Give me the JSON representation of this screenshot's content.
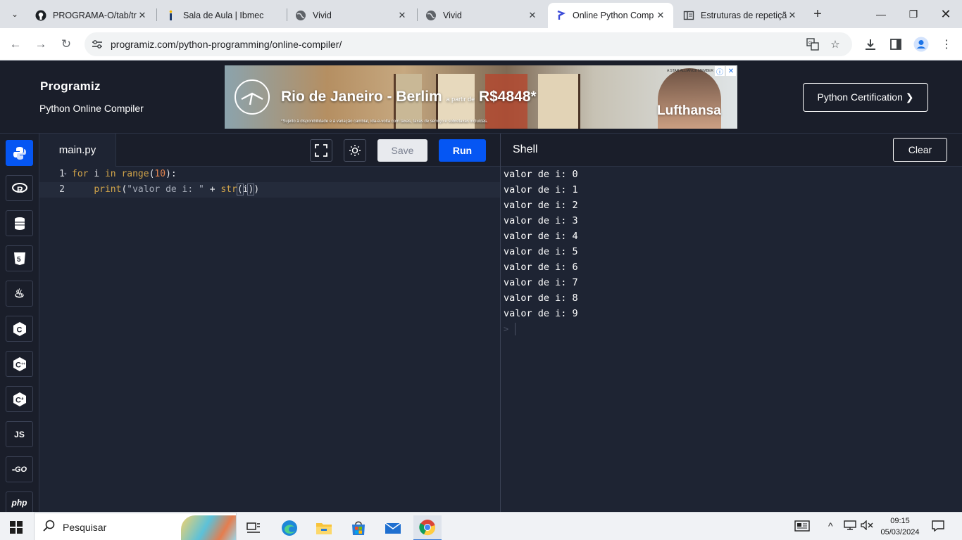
{
  "browser": {
    "tabs": [
      {
        "title": "PROGRAMA-O/tab/tr",
        "icon": "github-icon",
        "active": false
      },
      {
        "title": "Sala de Aula | Ibmec",
        "icon": "ibmec-icon",
        "active": false
      },
      {
        "title": "Vivid",
        "icon": "globe-icon",
        "active": false
      },
      {
        "title": "Vivid",
        "icon": "globe-icon",
        "active": false
      },
      {
        "title": "Online Python Comp",
        "icon": "programiz-icon",
        "active": true
      },
      {
        "title": "Estruturas de repetiçã",
        "icon": "book-icon",
        "active": false
      }
    ],
    "url": "programiz.com/python-programming/online-compiler/"
  },
  "site": {
    "logo": "Programiz",
    "subtitle": "Python Online Compiler",
    "certification_label": "Python Certification ❯",
    "ad": {
      "headline": "Rio de Janeiro - Berlim",
      "price_prefix": "a partir de",
      "price": "R$4848*",
      "fine_print": "*Sujeito à disponibilidade e à variação cambial, ida-e-volta com taxas, taxas de serviço e sobretaxas incluídas.",
      "brand": "Lufthansa",
      "badge": "A STAR ALLIANCE MEMBER"
    }
  },
  "ide": {
    "languages": [
      {
        "name": "python-lang",
        "label": "",
        "active": true
      },
      {
        "name": "r-lang",
        "label": "R",
        "active": false
      },
      {
        "name": "sql-lang",
        "label": "",
        "active": false
      },
      {
        "name": "html-lang",
        "label": "5",
        "active": false
      },
      {
        "name": "java-lang",
        "label": "♨",
        "active": false
      },
      {
        "name": "c-lang",
        "label": "C",
        "active": false
      },
      {
        "name": "cpp-lang",
        "label": "C",
        "active": false
      },
      {
        "name": "csharp-lang",
        "label": "C",
        "active": false
      },
      {
        "name": "js-lang",
        "label": "JS",
        "active": false
      },
      {
        "name": "go-lang",
        "label": "GO",
        "active": false
      },
      {
        "name": "php-lang",
        "label": "php",
        "active": false
      }
    ],
    "file_tab": "main.py",
    "save_label": "Save",
    "run_label": "Run",
    "code_lines": [
      {
        "number": "1",
        "text": "for i in range(10):"
      },
      {
        "number": "2",
        "text": "    print(\"valor de i: \" + str(i))"
      }
    ],
    "shell_title": "Shell",
    "clear_label": "Clear",
    "output": [
      "valor de i: 0",
      "valor de i: 1",
      "valor de i: 2",
      "valor de i: 3",
      "valor de i: 4",
      "valor de i: 5",
      "valor de i: 6",
      "valor de i: 7",
      "valor de i: 8",
      "valor de i: 9"
    ],
    "prompt": ">"
  },
  "taskbar": {
    "search_placeholder": "Pesquisar",
    "time": "09:15",
    "date": "05/03/2024"
  }
}
